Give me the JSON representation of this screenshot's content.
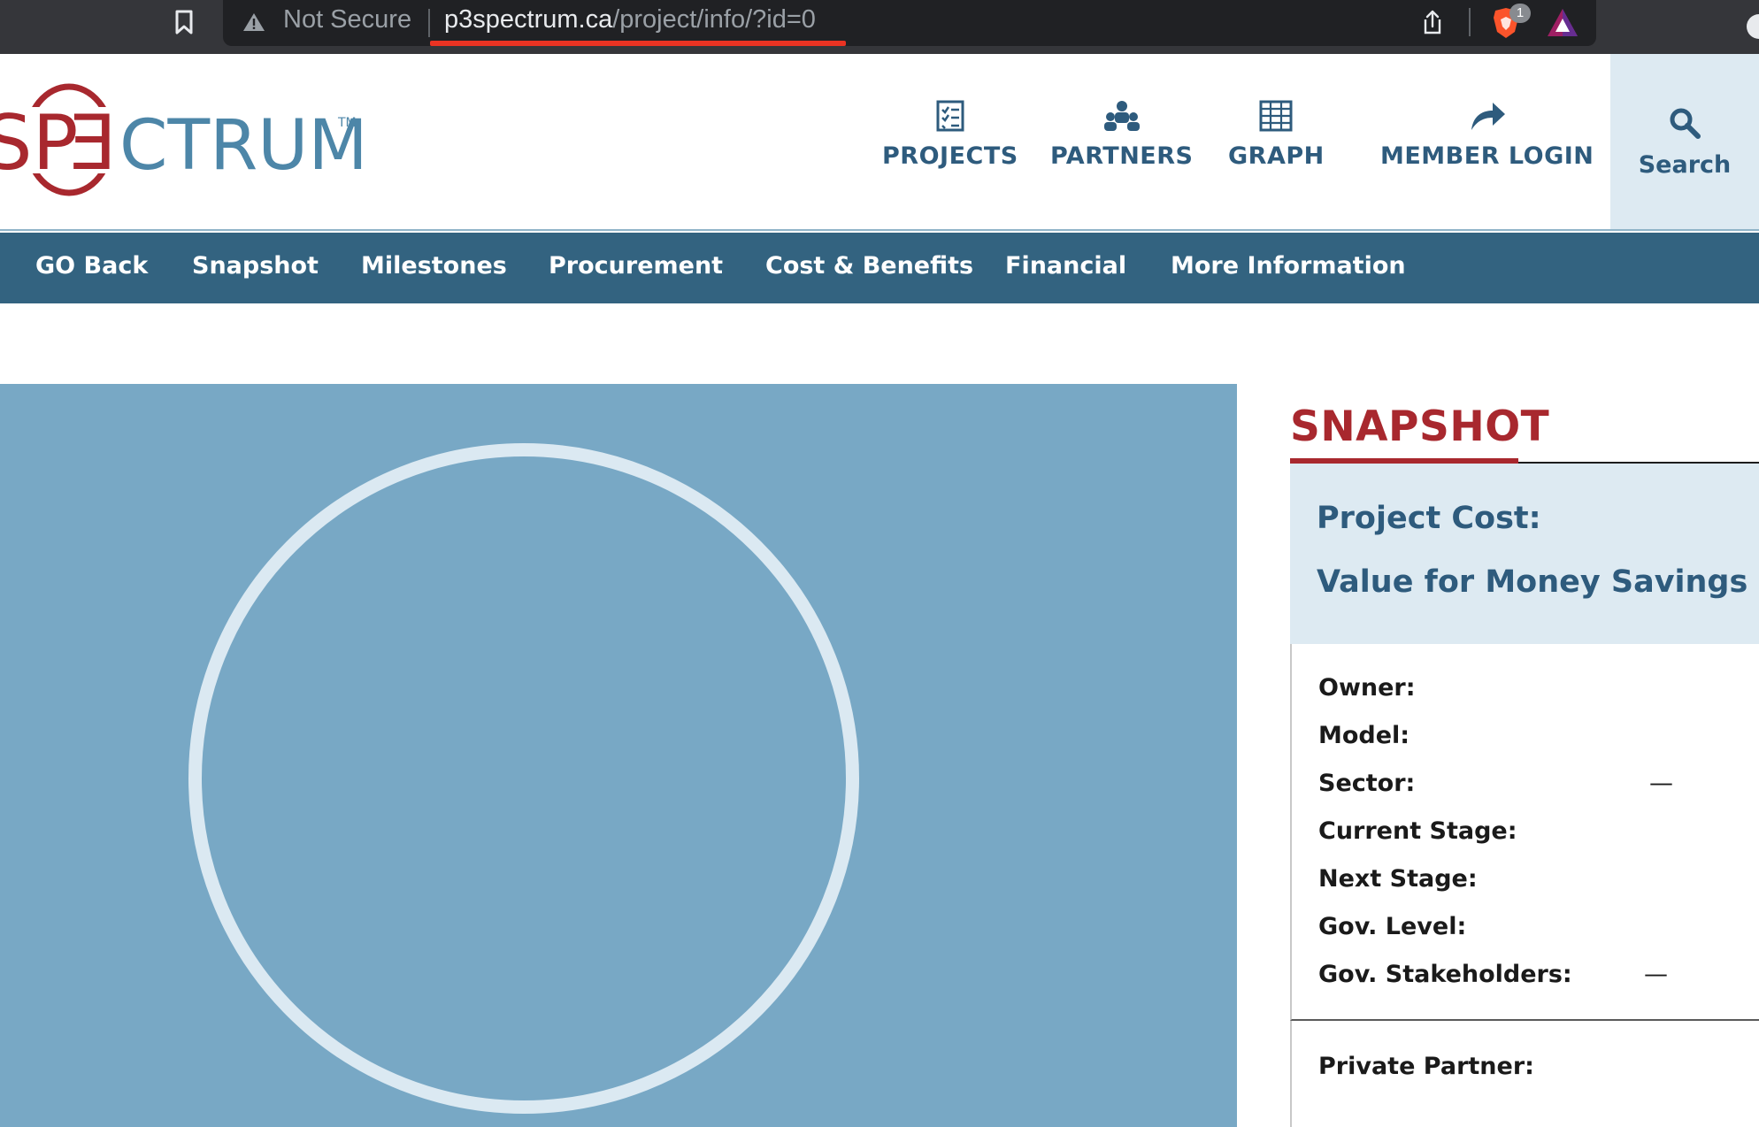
{
  "browser": {
    "security_label": "Not Secure",
    "url_host": "p3spectrum.ca",
    "url_path": "/project/info/?id=0",
    "shield_badge": "1",
    "icons": [
      "bookmark-icon",
      "warning-icon",
      "share-icon",
      "brave-shield-icon",
      "brave-rewards-icon"
    ]
  },
  "site": {
    "logo": {
      "text_prefix": "SP",
      "text_mid": "E",
      "text_suffix": "CTRUM",
      "tm": "TM"
    },
    "nav": [
      {
        "label": "PROJECTS",
        "icon": "checklist-icon"
      },
      {
        "label": "PARTNERS",
        "icon": "people-icon"
      },
      {
        "label": "GRAPH",
        "icon": "grid-icon"
      },
      {
        "label": "MEMBER LOGIN",
        "icon": "share-arrow-icon"
      }
    ],
    "search_label": "Search"
  },
  "subnav": [
    "GO Back",
    "Snapshot",
    "Milestones",
    "Procurement",
    "Cost & Benefits",
    "Financial",
    "More Information"
  ],
  "snapshot": {
    "title": "SNAPSHOT",
    "project_cost_label": "Project Cost:",
    "vfm_label": "Value for Money Savings",
    "rows": [
      {
        "label": "Owner:",
        "value": ""
      },
      {
        "label": "Model:",
        "value": ""
      },
      {
        "label": "Sector:",
        "value": "—"
      },
      {
        "label": "Current Stage:",
        "value": ""
      },
      {
        "label": "Next Stage:",
        "value": ""
      },
      {
        "label": "Gov. Level:",
        "value": ""
      },
      {
        "label": "Gov. Stakeholders:",
        "value": "—"
      }
    ],
    "private_partner_label": "Private Partner:"
  },
  "colors": {
    "brand_red": "#a8282e",
    "brand_blue": "#2e5b7d",
    "subnav_bg": "#336380",
    "hero_bg": "#78a8c5",
    "panel_bg": "#ddeaf2"
  }
}
